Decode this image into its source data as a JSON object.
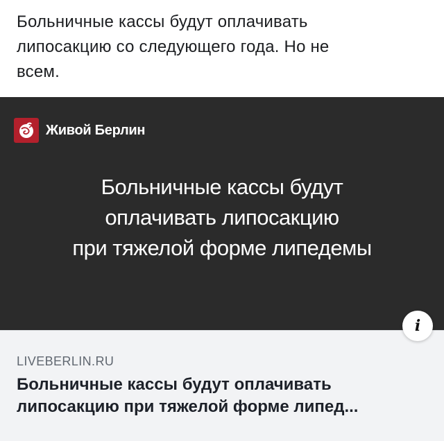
{
  "post": {
    "text": "Больничные кассы будут оплачивать\nлипосакцию со следующего года. Но не\nвсем."
  },
  "link_card": {
    "image": {
      "brand_name": "Живой Берлин",
      "headline_lines": [
        "Больничные кассы будут",
        "оплачивать липосакцию",
        "при тяжелой форме липедемы"
      ],
      "background_color": "#2b2b2b",
      "logo_color": "#b3202c"
    },
    "info_icon": "i",
    "domain": "LIVEBERLIN.RU",
    "title_lines": [
      "Больничные кассы будут оплачивать",
      "липосакцию при тяжелой форме липед..."
    ]
  }
}
